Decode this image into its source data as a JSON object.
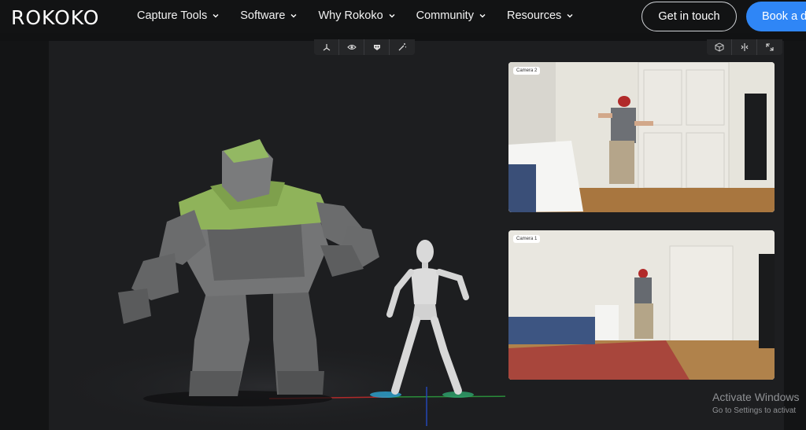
{
  "nav": {
    "logo": "ROKOKO",
    "items": [
      {
        "label": "Capture Tools"
      },
      {
        "label": "Software"
      },
      {
        "label": "Why Rokoko"
      },
      {
        "label": "Community"
      },
      {
        "label": "Resources"
      }
    ],
    "cta_secondary": "Get in touch",
    "cta_primary": "Book a d"
  },
  "viewer": {
    "toolbar_left": [
      "axes-icon",
      "eye-icon",
      "mask-icon",
      "magic-icon"
    ],
    "toolbar_right": [
      "cube-icon",
      "split-icon",
      "expand-icon"
    ],
    "cameras": [
      {
        "label": "Camera 2"
      },
      {
        "label": "Camera 1"
      }
    ]
  },
  "windows_notice": {
    "title": "Activate Windows",
    "subtitle": "Go to Settings to activat"
  },
  "colors": {
    "accent": "#2f86f6",
    "nav_bg": "#121314",
    "viewport_bg": "#1d1e20"
  }
}
